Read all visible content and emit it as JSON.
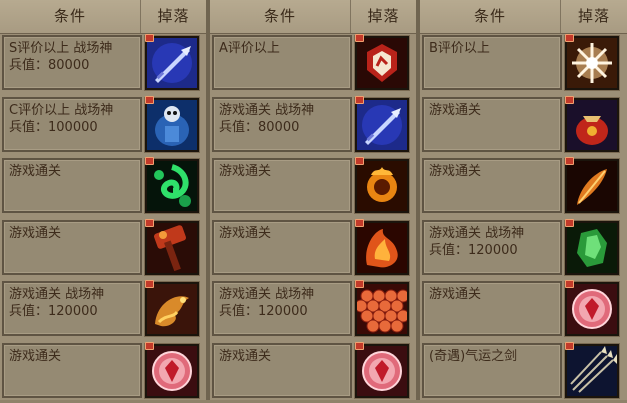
{
  "columns": [
    {
      "header_condition": "条件",
      "header_drop": "掉落",
      "rows": [
        {
          "lines": [
            "S评价以上 战场神",
            "兵值：80000"
          ],
          "icon": "blue-sword-icon"
        },
        {
          "lines": [
            "C评价以上 战场神",
            "兵值：100000"
          ],
          "icon": "blue-skull-armor-icon"
        },
        {
          "lines": [
            "游戏通关"
          ],
          "icon": "green-swirl-icon"
        },
        {
          "lines": [
            "游戏通关"
          ],
          "icon": "red-hammer-icon"
        },
        {
          "lines": [
            "游戏通关 战场神",
            "兵值：120000"
          ],
          "icon": "golden-dragon-icon"
        },
        {
          "lines": [
            "游戏通关"
          ],
          "icon": "red-orb-icon"
        }
      ]
    },
    {
      "header_condition": "条件",
      "header_drop": "掉落",
      "rows": [
        {
          "lines": [
            "A评价以上"
          ],
          "icon": "red-emblem-icon"
        },
        {
          "lines": [
            "游戏通关 战场神",
            "兵值：80000"
          ],
          "icon": "blue-sword-icon"
        },
        {
          "lines": [
            "游戏通关"
          ],
          "icon": "fire-ring-icon"
        },
        {
          "lines": [
            "游戏通关"
          ],
          "icon": "flame-helm-icon"
        },
        {
          "lines": [
            "游戏通关 战场神",
            "兵值：120000"
          ],
          "icon": "scale-armor-icon"
        },
        {
          "lines": [
            "游戏通关"
          ],
          "icon": "red-orb-icon"
        }
      ]
    },
    {
      "header_condition": "条件",
      "header_drop": "掉落",
      "rows": [
        {
          "lines": [
            "B评价以上"
          ],
          "icon": "white-burst-icon"
        },
        {
          "lines": [
            "游戏通关"
          ],
          "icon": "red-pouch-icon"
        },
        {
          "lines": [
            "游戏通关"
          ],
          "icon": "feather-quill-icon"
        },
        {
          "lines": [
            "游戏通关 战场神",
            "兵值：120000"
          ],
          "icon": "green-crystal-icon"
        },
        {
          "lines": [
            "游戏通关"
          ],
          "icon": "red-orb-icon"
        },
        {
          "lines": [
            "(奇遇)气运之剑"
          ],
          "icon": "arrows-icon"
        }
      ]
    }
  ],
  "colors": {
    "background": "#9c8f77",
    "text": "#3d2b1b",
    "slot_border": "#1b140c"
  }
}
